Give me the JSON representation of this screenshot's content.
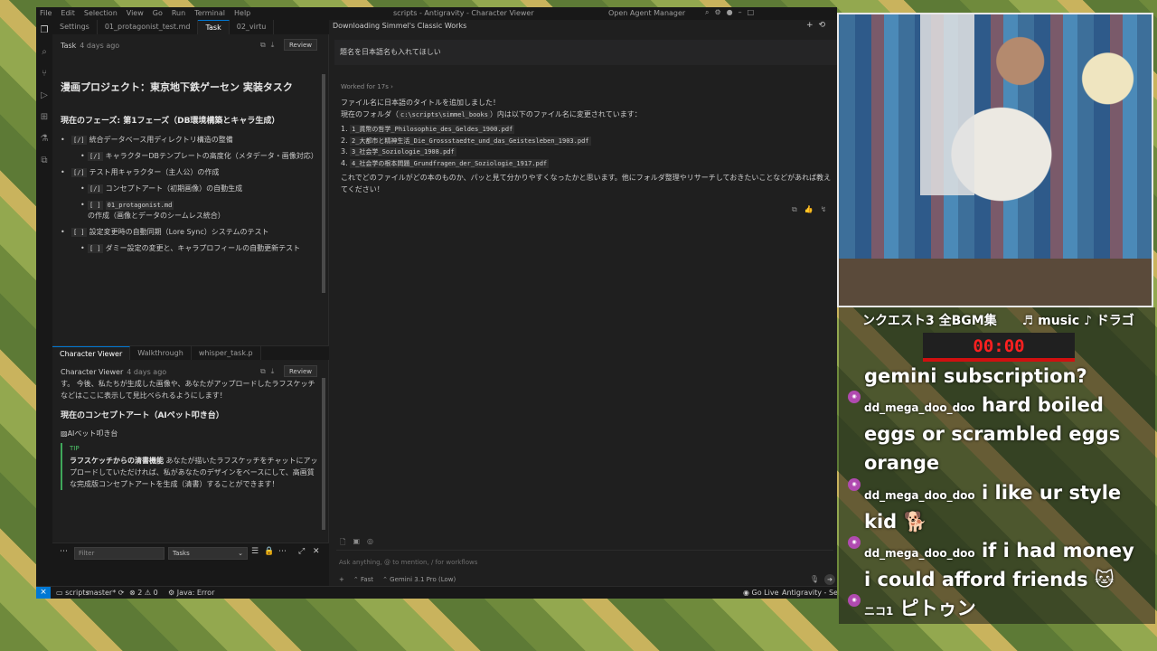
{
  "window": {
    "menu": [
      "File",
      "Edit",
      "Selection",
      "View",
      "Go",
      "Run",
      "Terminal",
      "Help"
    ],
    "title": "scripts - Antigravity - Character Viewer",
    "agent_manager": "Open Agent Manager"
  },
  "left_top": {
    "tabs": [
      "Settings",
      "01_protagonist_test.md",
      "Task",
      "02_virtu"
    ],
    "doc_title": "Task",
    "doc_time": "4 days ago",
    "review_label": "Review",
    "heading": "漫画プロジェクト：東京地下鉄ゲーセン 実装タスク",
    "phase_heading": "現在のフェーズ: 第1フェーズ（DB環境構築とキャラ生成）",
    "items": [
      {
        "check": "[/]",
        "text": "統合データベース用ディレクトリ構造の整備",
        "level": 1
      },
      {
        "check": "[/]",
        "text": "キャラクターDBテンプレートの高度化（メタデータ・画像対応）",
        "level": 2
      },
      {
        "check": "[/]",
        "text": "テスト用キャラクター（主人公）の作成",
        "level": 1
      },
      {
        "check": "[/]",
        "text": "コンセプトアート（初期画像）の自動生成",
        "level": 2
      },
      {
        "check": "[ ]",
        "code": "01_protagonist.md",
        "text": "の作成（画像とデータのシームレス統合）",
        "level": 2
      },
      {
        "check": "[ ]",
        "text": "設定変更時の自動同期（Lore Sync）システムのテスト",
        "level": 1
      },
      {
        "check": "[ ]",
        "text": "ダミー設定の変更と、キャラプロフィールの自動更新テスト",
        "level": 2
      }
    ]
  },
  "left_bottom": {
    "tabs": [
      "Character Viewer",
      "Walkthrough",
      "whisper_task.p"
    ],
    "doc_title": "Character Viewer",
    "doc_time": "4 days ago",
    "review_label": "Review",
    "intro": "す。 今後、私たちが生成した画像や、あなたがアップロードしたラフスケッチなどはここに表示して見比べられるようにします！",
    "concept_heading": "現在のコンセプトアート（AIペット叩き台）",
    "image_alt": "AIペット叩き台",
    "tip_label": "TIP",
    "tip_bold": "ラフスケッチからの清書機能",
    "tip_text": "あなたが描いたラフスケッチをチャットにアップロードしていただければ、私があなたのデザインをベースにして、高画質な完成版コンセプトアートを生成（清書）することができます！"
  },
  "panel": {
    "filter_placeholder": "Filter",
    "task_select": "Tasks"
  },
  "chat": {
    "title": "Downloading Simmel's Classic Works",
    "user_message": "題名を日本語名も入れてほしい",
    "worked_for": "Worked for 17s",
    "reply_line1": "ファイル名に日本語のタイトルを追加しました！",
    "reply_line2_pre": "現在のフォルダ（",
    "reply_path": "c:\\scripts\\simmel_books",
    "reply_line2_post": "）内は以下のファイル名に変更されています：",
    "files": [
      "1_貨幣の哲学_Philosophie_des_Geldes_1900.pdf",
      "2_大都市と精神生活_Die_Grossstaedte_und_das_Geistesleben_1903.pdf",
      "3_社会学_Soziologie_1908.pdf",
      "4_社会学の根本問題_Grundfragen_der_Soziologie_1917.pdf"
    ],
    "reply_outro": "これでどのファイルがどの本のものか、パッと見て分かりやすくなったかと思います。他にフォルダ整理やリサーチしておきたいことなどがあれば教えてください！",
    "input_placeholder": "Ask anything, @ to mention, / for workflows",
    "mode": "Fast",
    "model": "Gemini 3.1 Pro (Low)"
  },
  "statusbar": {
    "folder": "scripts",
    "branch": "master*",
    "errors": "2",
    "warnings": "0",
    "java": "Java: Error",
    "golive": "Go Live",
    "settings": "Antigravity - Settings"
  },
  "overlay": {
    "ticker": "ンクエスト3 全BGM集　　♬ music ♪ ドラゴ",
    "timer": "00:00",
    "messages": [
      {
        "user": "",
        "text": "gemini subscription?"
      },
      {
        "user": "dd_mega_doo_doo",
        "text": "hard boiled"
      },
      {
        "user": "",
        "text": "eggs or scrambled eggs"
      },
      {
        "user": "",
        "text": "orange"
      },
      {
        "user": "dd_mega_doo_doo",
        "text": "i like ur style"
      },
      {
        "user": "",
        "text": "kid 🐕"
      },
      {
        "user": "dd_mega_doo_doo",
        "text": "if i had money"
      },
      {
        "user": "",
        "text": "i could afford friends 🐱"
      },
      {
        "user": "ニコ1",
        "text": "ピトゥン"
      }
    ]
  }
}
